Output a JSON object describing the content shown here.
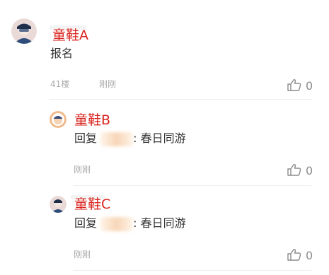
{
  "comments": [
    {
      "user": "童鞋A",
      "text": "报名",
      "floor": "41楼",
      "time": "刚刚",
      "likes": "0"
    },
    {
      "user": "童鞋B",
      "reply_prefix": "回复",
      "reply_suffix": ": 春日同游",
      "time": "刚刚",
      "likes": "0"
    },
    {
      "user": "童鞋C",
      "reply_prefix": "回复",
      "reply_suffix": ": 春日同游",
      "time": "刚刚",
      "likes": "0"
    }
  ],
  "colors": {
    "username": "#d9231e",
    "meta": "#aaaaaa",
    "divider": "#eeeeee"
  },
  "icons": [
    "avatar",
    "thumbs-up-icon"
  ]
}
